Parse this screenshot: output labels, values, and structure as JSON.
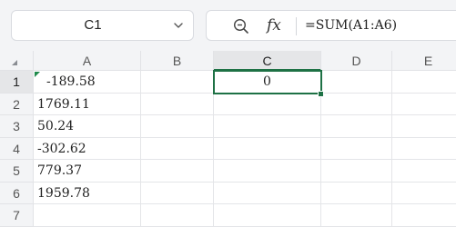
{
  "name_box": {
    "value": "C1"
  },
  "formula_bar": {
    "formula": "=SUM(A1:A6)",
    "fx_label": "fx"
  },
  "sheet": {
    "columns": [
      "A",
      "B",
      "C",
      "D",
      "E"
    ],
    "rows": [
      "1",
      "2",
      "3",
      "4",
      "5",
      "6",
      "7"
    ],
    "selected_cell": "C1",
    "cells": {
      "A1": "-189.58",
      "A2": "1769.11",
      "A3": "50.24",
      "A4": "-302.62",
      "A5": "779.37",
      "A6": "1959.78",
      "C1": "0"
    }
  },
  "colors": {
    "accent": "#1e7145",
    "header_bg": "#f3f4f6"
  }
}
